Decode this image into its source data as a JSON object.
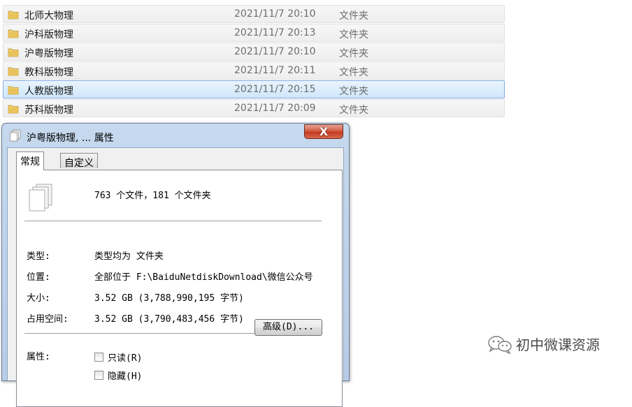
{
  "files": [
    {
      "name": "北师大物理",
      "date": "2021/11/7 20:10",
      "type": "文件夹",
      "selected": false
    },
    {
      "name": "沪科版物理",
      "date": "2021/11/7 20:13",
      "type": "文件夹",
      "selected": false
    },
    {
      "name": "沪粤版物理",
      "date": "2021/11/7 20:10",
      "type": "文件夹",
      "selected": false
    },
    {
      "name": "教科版物理",
      "date": "2021/11/7 20:11",
      "type": "文件夹",
      "selected": false
    },
    {
      "name": "人教版物理",
      "date": "2021/11/7 20:15",
      "type": "文件夹",
      "selected": true
    },
    {
      "name": "苏科版物理",
      "date": "2021/11/7 20:09",
      "type": "文件夹",
      "selected": false
    }
  ],
  "dialog": {
    "title": "沪粤版物理, ... 属性",
    "close_label": "X",
    "tabs": [
      "常规",
      "自定义"
    ],
    "active_tab": 0,
    "summary": "763 个文件，181 个文件夹",
    "properties": [
      {
        "label": "类型:",
        "value": "类型均为 文件夹"
      },
      {
        "label": "位置:",
        "value": "全部位于 F:\\BaiduNetdiskDownload\\微信公众号"
      },
      {
        "label": "大小:",
        "value": "3.52 GB (3,788,990,195 字节)"
      },
      {
        "label": "占用空间:",
        "value": "3.52 GB (3,790,483,456 字节)"
      }
    ],
    "attributes_label": "属性:",
    "checkboxes": [
      {
        "label": "只读(R)",
        "checked": false
      },
      {
        "label": "隐藏(H)",
        "checked": false
      }
    ],
    "advanced_label": "高级(D)..."
  },
  "watermark": {
    "text": "初中微课资源",
    "icon": "wechat-icon"
  },
  "colors": {
    "selection": "#cfe7fb",
    "selection_border": "#84acdd",
    "dialog_frame": "#b7cde7",
    "close_button": "#c4371f",
    "folder": "#e8c25a"
  }
}
